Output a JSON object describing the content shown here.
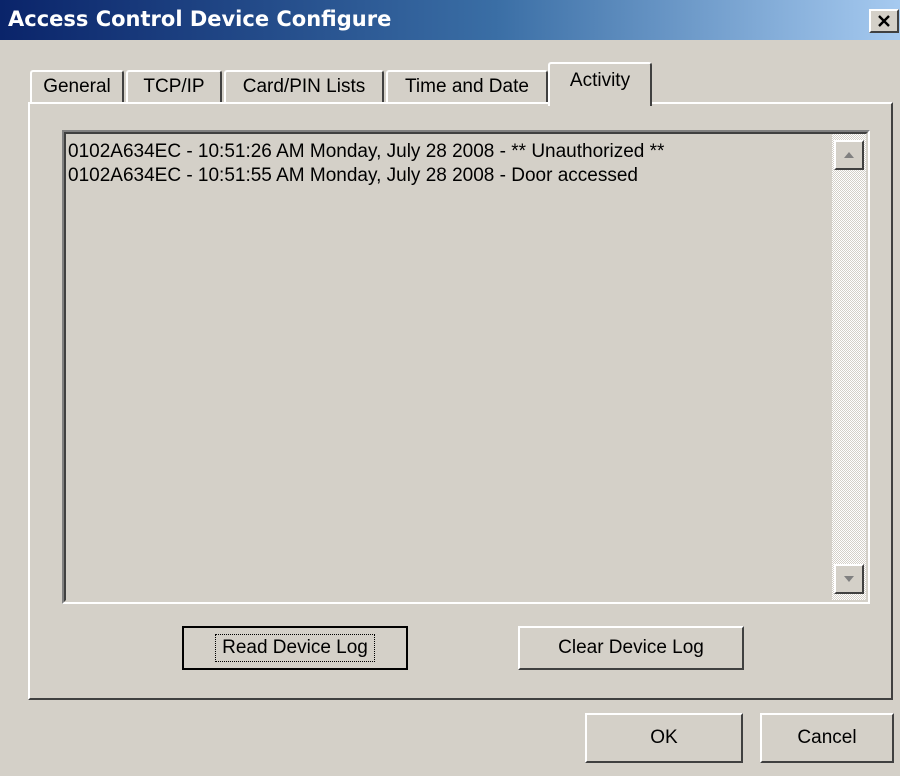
{
  "window": {
    "title": "Access Control Device Configure",
    "close_label": "✕"
  },
  "tabs": [
    {
      "label": "General",
      "active": false
    },
    {
      "label": "TCP/IP",
      "active": false
    },
    {
      "label": "Card/PIN Lists",
      "active": false
    },
    {
      "label": "Time and Date",
      "active": false
    },
    {
      "label": "Activity",
      "active": true
    }
  ],
  "activity": {
    "log_lines": [
      "0102A634EC - 10:51:26 AM  Monday, July 28 2008 - ** Unauthorized **",
      "0102A634EC - 10:51:55 AM  Monday, July 28 2008 - Door accessed"
    ],
    "read_button": "Read Device Log",
    "clear_button": "Clear Device Log"
  },
  "footer": {
    "ok_label": "OK",
    "cancel_label": "Cancel"
  },
  "colors": {
    "face": "#d4d0c8",
    "title_start": "#0a246a",
    "title_end": "#a6caf0"
  },
  "icons": {
    "close": "close-icon",
    "scroll_up": "arrow-up-icon",
    "scroll_down": "arrow-down-icon"
  }
}
